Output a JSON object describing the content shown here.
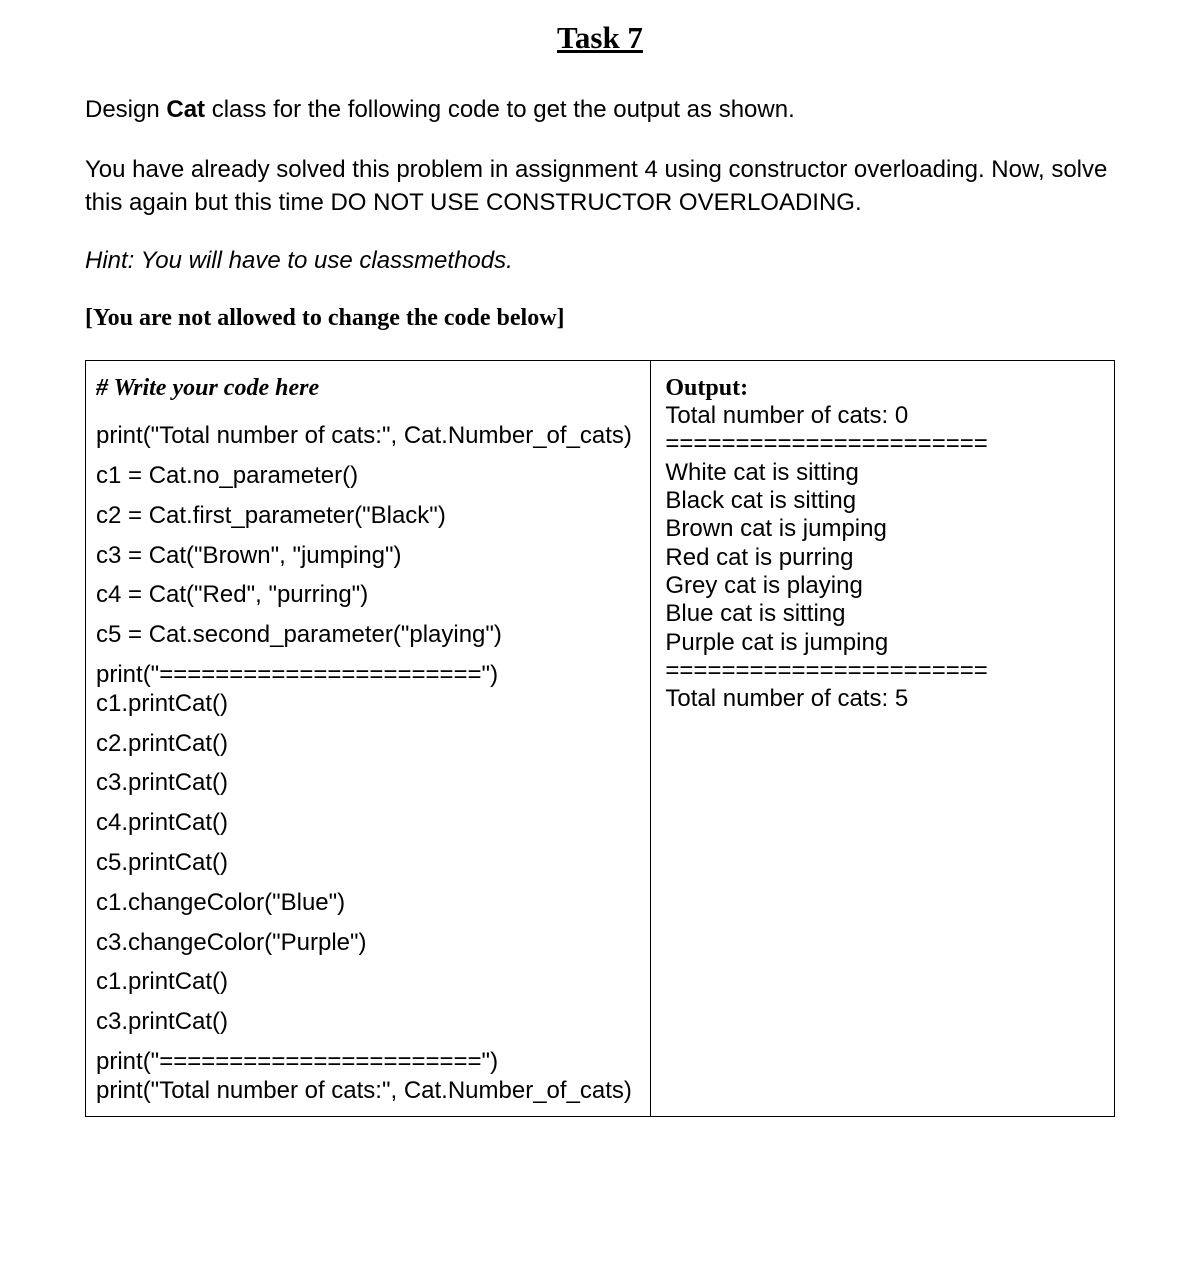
{
  "title": "Task 7",
  "intro": {
    "prefix": "Design ",
    "bold": "Cat",
    "suffix": " class for the following code to get the output as shown."
  },
  "paragraph": "You have already solved this problem in assignment 4 using constructor overloading. Now, solve this again but this time DO NOT USE CONSTRUCTOR OVERLOADING.",
  "hint": "Hint: You will have to use classmethods.",
  "restriction": "[You are not allowed to change the code below]",
  "code": {
    "comment": "# Write your code here",
    "lines": [
      "print(\"Total number of cats:\", Cat.Number_of_cats)",
      "c1 = Cat.no_parameter()",
      "c2 = Cat.first_parameter(\"Black\")",
      "c3 = Cat(\"Brown\", \"jumping\")",
      "c4 = Cat(\"Red\", \"purring\")",
      "c5 = Cat.second_parameter(\"playing\")",
      "print(\"=======================\")",
      "c1.printCat()",
      "c2.printCat()",
      "c3.printCat()",
      "c4.printCat()",
      "c5.printCat()",
      "c1.changeColor(\"Blue\")",
      "c3.changeColor(\"Purple\")",
      "c1.printCat()",
      "c3.printCat()",
      "print(\"=======================\")",
      "print(\"Total number of cats:\", Cat.Number_of_cats)"
    ]
  },
  "output": {
    "header": "Output:",
    "lines": [
      "Total number of cats: 0",
      "=======================",
      "White cat is sitting",
      "Black cat is sitting",
      "Brown cat is jumping",
      "Red cat is purring",
      "Grey cat is playing",
      "Blue cat is sitting",
      "Purple cat is jumping",
      "=======================",
      "Total number of cats: 5"
    ]
  }
}
